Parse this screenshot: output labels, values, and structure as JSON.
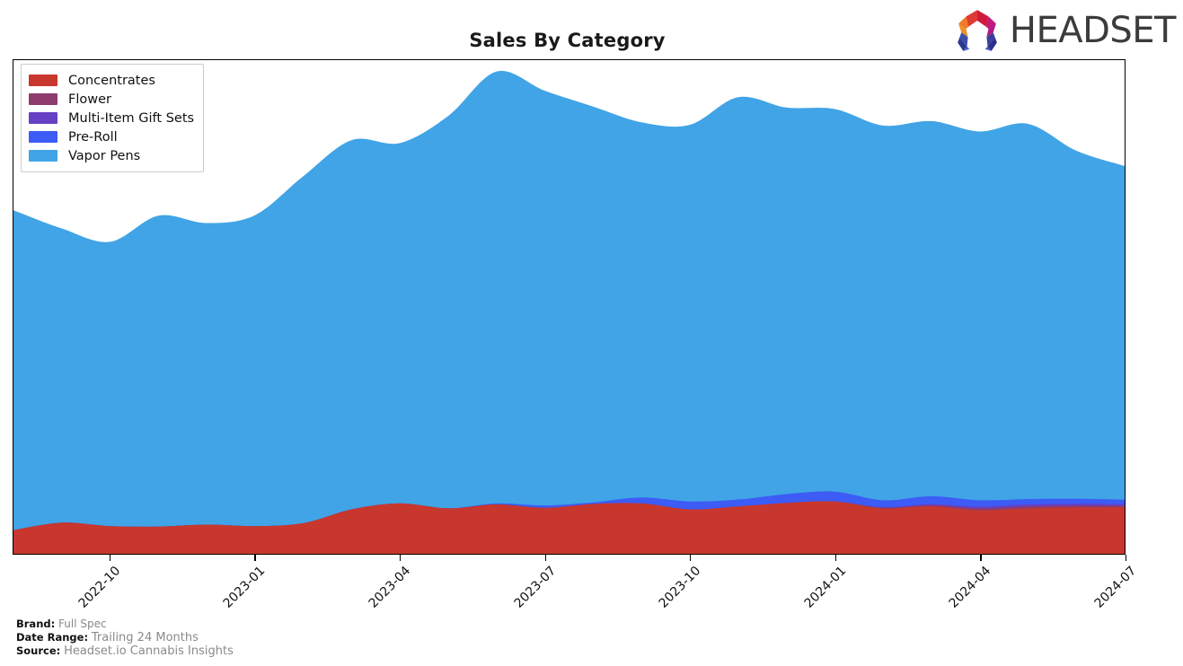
{
  "header": {
    "title": "Sales By Category",
    "logo_word": "HEADSET",
    "logo_name": "headset-logo"
  },
  "legend": {
    "position": "upper-left",
    "items": [
      {
        "label": "Concentrates",
        "color": "#c8372d"
      },
      {
        "label": "Flower",
        "color": "#8e3b6d"
      },
      {
        "label": "Multi-Item Gift Sets",
        "color": "#6640c4"
      },
      {
        "label": "Pre-Roll",
        "color": "#3c5cf5"
      },
      {
        "label": "Vapor Pens",
        "color": "#41a4e6"
      }
    ]
  },
  "footer": {
    "brand_label": "Brand:",
    "brand_value": "Full Spec",
    "date_range_label": "Date Range:",
    "date_range_value": "Trailing 24 Months",
    "source_label": "Source:",
    "source_value": "Headset.io Cannabis Insights"
  },
  "chart_data": {
    "type": "area",
    "stacked": true,
    "title": "Sales By Category",
    "xlabel": "",
    "ylabel": "",
    "grid": false,
    "legend_position": "upper left",
    "axis_y_visible": false,
    "x": [
      "2022-08",
      "2022-09",
      "2022-10",
      "2022-11",
      "2022-12",
      "2023-01",
      "2023-02",
      "2023-03",
      "2023-04",
      "2023-05",
      "2023-06",
      "2023-07",
      "2023-08",
      "2023-09",
      "2023-10",
      "2023-11",
      "2023-12",
      "2024-01",
      "2024-02",
      "2024-03",
      "2024-04",
      "2024-05",
      "2024-06",
      "2024-07"
    ],
    "tick_labels": [
      "2022-10",
      "2023-01",
      "2023-04",
      "2023-07",
      "2023-10",
      "2024-01",
      "2024-04",
      "2024-07"
    ],
    "tick_x": [
      "2022-10",
      "2023-01",
      "2023-04",
      "2023-07",
      "2023-10",
      "2024-01",
      "2024-04",
      "2024-07"
    ],
    "ylim": [
      0,
      100
    ],
    "series": [
      {
        "name": "Concentrates",
        "color": "#c8372d",
        "values": [
          4.8,
          6.3,
          5.6,
          5.5,
          5.9,
          5.6,
          6.2,
          9.0,
          10.2,
          9.2,
          10.0,
          9.3,
          10.1,
          10.2,
          9.0,
          9.6,
          10.3,
          10.6,
          9.2,
          9.6,
          8.8,
          9.2,
          9.4,
          9.4
        ]
      },
      {
        "name": "Flower",
        "color": "#8e3b6d",
        "values": [
          0.0,
          0.0,
          0.0,
          0.0,
          0.0,
          0.0,
          0.0,
          0.0,
          0.0,
          0.0,
          0.0,
          0.0,
          0.0,
          0.0,
          0.0,
          0.0,
          0.0,
          0.0,
          0.15,
          0.25,
          0.4,
          0.4,
          0.35,
          0.3
        ]
      },
      {
        "name": "Multi-Item Gift Sets",
        "color": "#6640c4",
        "values": [
          0.0,
          0.0,
          0.0,
          0.0,
          0.0,
          0.0,
          0.0,
          0.0,
          0.0,
          0.0,
          0.0,
          0.0,
          0.0,
          0.0,
          0.0,
          0.0,
          0.0,
          0.0,
          0.1,
          0.2,
          0.35,
          0.4,
          0.4,
          0.35
        ]
      },
      {
        "name": "Pre-Roll",
        "color": "#3c5cf5",
        "values": [
          0.0,
          0.0,
          0.0,
          0.0,
          0.0,
          0.0,
          0.0,
          0.0,
          0.0,
          0.0,
          0.2,
          0.5,
          0.3,
          1.2,
          1.6,
          1.4,
          1.8,
          2.0,
          1.4,
          1.6,
          1.3,
          1.1,
          1.0,
          0.9
        ]
      },
      {
        "name": "Vapor Pens",
        "color": "#41a4e6",
        "values": [
          64.8,
          59.6,
          57.6,
          63.0,
          61.1,
          63.0,
          70.3,
          74.8,
          73.0,
          79.5,
          87.5,
          84.0,
          80.2,
          76.0,
          76.3,
          81.5,
          78.3,
          77.5,
          75.9,
          76.0,
          74.7,
          76.0,
          70.5,
          67.6
        ]
      }
    ]
  }
}
